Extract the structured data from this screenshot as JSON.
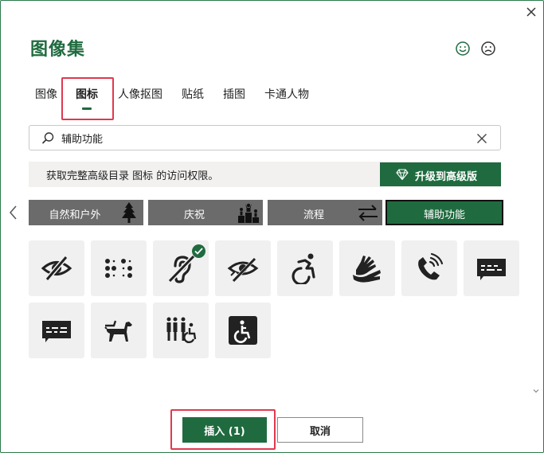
{
  "dialog": {
    "title": "图像集",
    "tabs": [
      {
        "label": "图像",
        "active": false
      },
      {
        "label": "图标",
        "active": true
      },
      {
        "label": "人像抠图",
        "active": false
      },
      {
        "label": "贴纸",
        "active": false
      },
      {
        "label": "插图",
        "active": false
      },
      {
        "label": "卡通人物",
        "active": false
      }
    ],
    "search": {
      "value": "辅助功能",
      "placeholder": ""
    },
    "upsell": {
      "message": "获取完整高级目录 图标 的访问权限。",
      "button_label": "升级到高级版"
    },
    "categories": [
      {
        "label": "自然和户外",
        "active": false
      },
      {
        "label": "庆祝",
        "active": false
      },
      {
        "label": "流程",
        "active": false
      },
      {
        "label": "辅助功能",
        "active": true
      }
    ],
    "icons": [
      {
        "name": "eye-slash-icon",
        "selected": false
      },
      {
        "name": "braille-icon",
        "selected": false
      },
      {
        "name": "hearing-impaired-icon",
        "selected": true
      },
      {
        "name": "low-vision-icon",
        "selected": false
      },
      {
        "name": "wheelchair-active-icon",
        "selected": false
      },
      {
        "name": "sign-language-icon",
        "selected": false
      },
      {
        "name": "volume-control-phone-icon",
        "selected": false
      },
      {
        "name": "tty-caption-icon",
        "selected": false
      },
      {
        "name": "closed-caption-icon",
        "selected": false
      },
      {
        "name": "service-dog-icon",
        "selected": false
      },
      {
        "name": "family-restroom-icon",
        "selected": false
      },
      {
        "name": "accessible-square-icon",
        "selected": false
      }
    ],
    "buttons": {
      "insert": "插入 (1)",
      "cancel": "取消"
    },
    "colors": {
      "accent": "#1f6b3f",
      "highlight": "#e0394f",
      "category_bg": "#6b6b6b",
      "tile_bg": "#f0f0f0"
    }
  }
}
